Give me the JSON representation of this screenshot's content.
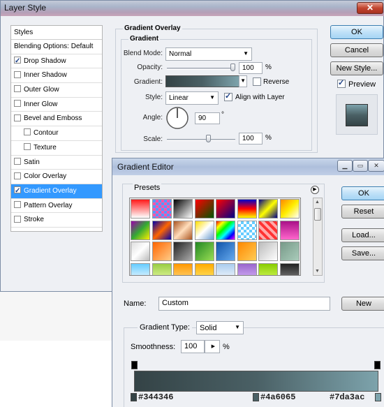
{
  "layer_style": {
    "title": "Layer Style",
    "close_symbol": "✕",
    "styles_header": "Styles",
    "blending_options": "Blending Options: Default",
    "styles": [
      {
        "label": "Drop Shadow",
        "checked": true,
        "selected": false
      },
      {
        "label": "Inner Shadow",
        "checked": false,
        "selected": false
      },
      {
        "label": "Outer Glow",
        "checked": false,
        "selected": false
      },
      {
        "label": "Inner Glow",
        "checked": false,
        "selected": false
      },
      {
        "label": "Bevel and Emboss",
        "checked": false,
        "selected": false
      },
      {
        "label": "Contour",
        "checked": false,
        "selected": false
      },
      {
        "label": "Texture",
        "checked": false,
        "selected": false
      },
      {
        "label": "Satin",
        "checked": false,
        "selected": false
      },
      {
        "label": "Color Overlay",
        "checked": false,
        "selected": false
      },
      {
        "label": "Gradient Overlay",
        "checked": true,
        "selected": true
      },
      {
        "label": "Pattern Overlay",
        "checked": false,
        "selected": false
      },
      {
        "label": "Stroke",
        "checked": false,
        "selected": false
      }
    ],
    "section_title": "Gradient Overlay",
    "group_title": "Gradient",
    "blend_mode_label": "Blend Mode:",
    "blend_mode_value": "Normal",
    "opacity_label": "Opacity:",
    "opacity_value": "100",
    "percent": "%",
    "gradient_label": "Gradient:",
    "reverse_label": "Reverse",
    "reverse_checked": false,
    "style_label": "Style:",
    "style_value": "Linear",
    "align_label": "Align with Layer",
    "align_checked": true,
    "angle_label": "Angle:",
    "angle_value": "90",
    "degree": "°",
    "scale_label": "Scale:",
    "scale_value": "100",
    "ok_label": "OK",
    "cancel_label": "Cancel",
    "new_style_label": "New Style...",
    "preview_label": "Preview",
    "preview_checked": true
  },
  "gradient_editor": {
    "title": "Gradient Editor",
    "presets_label": "Presets",
    "ok_label": "OK",
    "reset_label": "Reset",
    "load_label": "Load...",
    "save_label": "Save...",
    "name_label": "Name:",
    "name_value": "Custom",
    "new_label": "New",
    "gradient_type_label": "Gradient Type:",
    "gradient_type_value": "Solid",
    "smoothness_label": "Smoothness:",
    "smoothness_value": "100",
    "percent": "%",
    "stops": [
      {
        "color": "#344346",
        "label": "#344346",
        "location_pct": 0
      },
      {
        "color": "#4a6065",
        "label": "#4a6065",
        "location_pct": 50
      },
      {
        "color": "#7da3ac",
        "label": "#7da3ac",
        "location_pct": 100
      }
    ],
    "preset_gradients": [
      "linear-gradient(#ff1a1a,#fff)",
      "repeating-conic-gradient(#ff55aa 0 25%, #5599ff 0 50%) 0 0/8px 8px",
      "linear-gradient(135deg,#000,#fff)",
      "linear-gradient(135deg,#ff0000,#005500)",
      "linear-gradient(135deg,#ff0000,#000088)",
      "linear-gradient(#0000cc,#ff0000,#ffff00)",
      "linear-gradient(135deg,#000088,#ffff00,#000088)",
      "linear-gradient(135deg,#ff8800,#ffee00,#ffffff)",
      "linear-gradient(135deg,#9900aa,#33aa33,#ffee00)",
      "linear-gradient(135deg,#0000aa,#ff6600,#0000aa)",
      "linear-gradient(135deg,#aa5522,#ffddbb,#aa5522)",
      "linear-gradient(135deg,#ffdd00,#fff,#6699cc)",
      "linear-gradient(135deg,#ff0000,#ffff00,#00ff00,#00ffff,#0000ff,#ff00ff)",
      "repeating-conic-gradient(#66ccff 0 25%, #ffffff 0 50%) 0 0/8px 8px",
      "repeating-linear-gradient(45deg,#ff3333 0 4px,#ffaaaa 4px 8px)",
      "linear-gradient(#aa1188,#ff66cc)",
      "linear-gradient(135deg,#dddddd,#ffffff,#bbbbbb)",
      "linear-gradient(135deg,#ff6600,#ffcc88)",
      "linear-gradient(135deg,#222222,#aaaaaa)",
      "linear-gradient(135deg,#228822,#99dd55)",
      "linear-gradient(135deg,#1155aa,#66aaee)",
      "linear-gradient(135deg,#ff8800,#ffcc55)",
      "linear-gradient(135deg,#bbbbbb,#ffffff)",
      "linear-gradient(135deg,#779988,#aaccbb)",
      "linear-gradient(#66ccff,#ffffff)",
      "linear-gradient(#99cc44,#eeffaa)",
      "linear-gradient(#ff9900,#ffdd88)",
      "linear-gradient(#ffaa00,#ffee77)",
      "linear-gradient(#aaccee,#ffffff)",
      "linear-gradient(#9966cc,#ddbbff)",
      "linear-gradient(#88cc00,#ddff66)",
      "linear-gradient(#222222,#888888)"
    ]
  }
}
